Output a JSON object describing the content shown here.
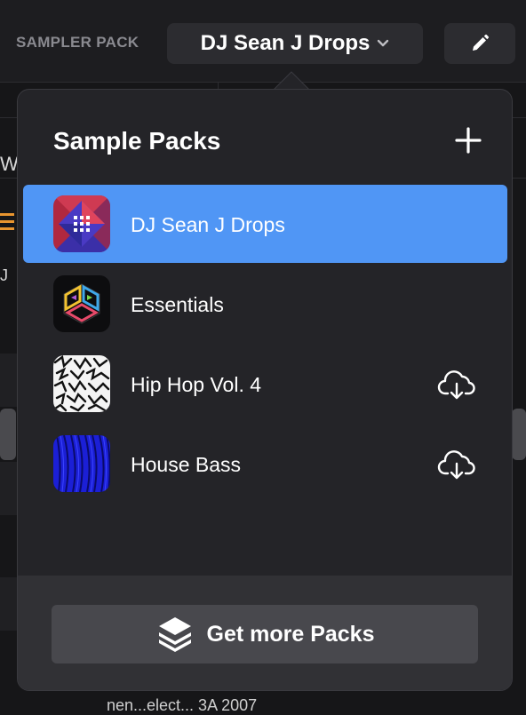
{
  "header": {
    "sampler_label": "SAMPLER PACK",
    "selected_pack": "DJ Sean J Drops",
    "edit_icon": "pencil-icon"
  },
  "popover": {
    "title": "Sample Packs",
    "add_icon": "plus-icon",
    "packs": [
      {
        "label": "DJ Sean J Drops",
        "selected": true,
        "downloaded": true,
        "icon": "grid-pack-icon"
      },
      {
        "label": "Essentials",
        "selected": false,
        "downloaded": true,
        "icon": "essentials-pack-icon"
      },
      {
        "label": "Hip Hop Vol. 4",
        "selected": false,
        "downloaded": false,
        "icon": "cloud-download-icon"
      },
      {
        "label": "House Bass",
        "selected": false,
        "downloaded": false,
        "icon": "cloud-download-icon"
      }
    ],
    "get_more_label": "Get more Packs",
    "get_more_icon": "layers-icon"
  },
  "background": {
    "fragment_w": "W",
    "fragment_j": "J",
    "bottom_text": "nen...elect...  3A        2007"
  },
  "colors": {
    "selected_row": "#5096f5",
    "accent_orange": "#e8952f"
  }
}
